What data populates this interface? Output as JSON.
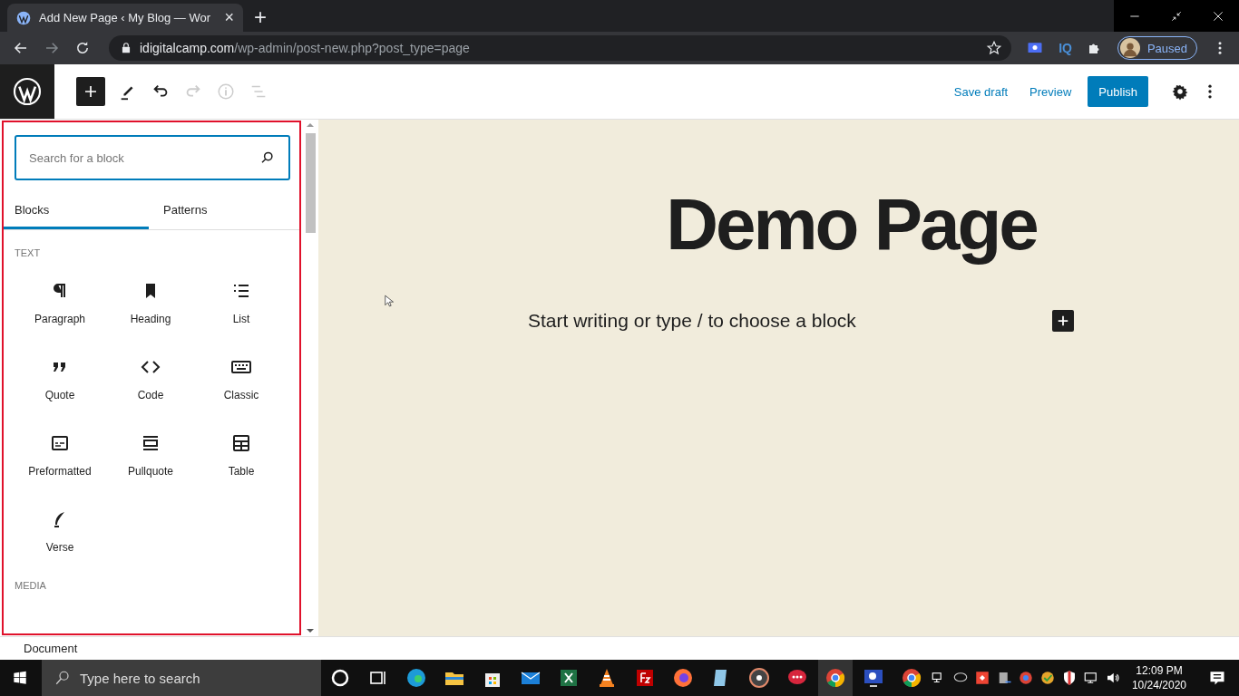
{
  "browser": {
    "tab": {
      "title": "Add New Page ‹ My Blog — Wor",
      "close": "×"
    },
    "new_tab": "+",
    "url": {
      "host": "idigitalcamp.com",
      "path": "/wp-admin/post-new.php?post_type=page"
    },
    "extension_label": "IQ",
    "profile": {
      "label": "Paused"
    }
  },
  "editor_header": {
    "save_draft": "Save draft",
    "preview": "Preview",
    "publish": "Publish"
  },
  "inserter": {
    "search": {
      "placeholder": "Search for a block"
    },
    "tabs": [
      {
        "label": "Blocks",
        "selected": true
      },
      {
        "label": "Patterns",
        "selected": false
      }
    ],
    "sections": [
      {
        "heading": "TEXT",
        "blocks": [
          {
            "label": "Paragraph"
          },
          {
            "label": "Heading"
          },
          {
            "label": "List"
          },
          {
            "label": "Quote"
          },
          {
            "label": "Code"
          },
          {
            "label": "Classic"
          },
          {
            "label": "Preformatted"
          },
          {
            "label": "Pullquote"
          },
          {
            "label": "Table"
          },
          {
            "label": "Verse"
          }
        ]
      },
      {
        "heading": "MEDIA"
      }
    ]
  },
  "canvas": {
    "title": "Demo Page",
    "placeholder": "Start writing or type / to choose a block"
  },
  "footer": {
    "breadcrumb": "Document"
  },
  "taskbar": {
    "search": {
      "placeholder": "Type here to search"
    },
    "time": "12:09 PM",
    "date": "10/24/2020"
  }
}
